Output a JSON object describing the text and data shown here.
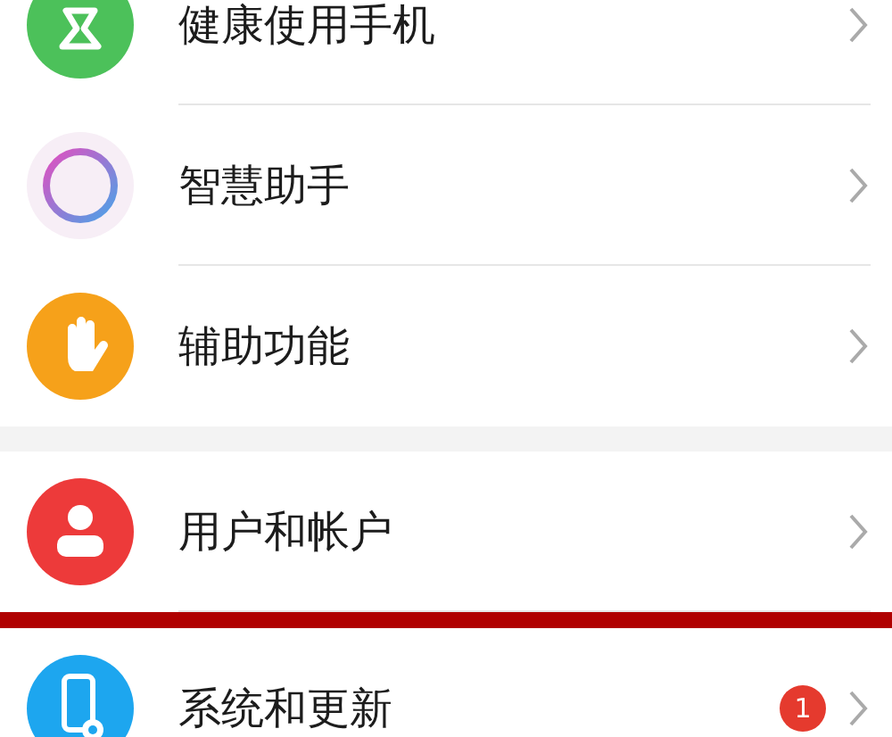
{
  "sections": [
    {
      "items": [
        {
          "label": "健康使用手机"
        },
        {
          "label": "智慧助手"
        },
        {
          "label": "辅助功能"
        }
      ]
    },
    {
      "items": [
        {
          "label": "用户和帐户"
        },
        {
          "label": "系统和更新",
          "badge": "1"
        }
      ]
    }
  ]
}
